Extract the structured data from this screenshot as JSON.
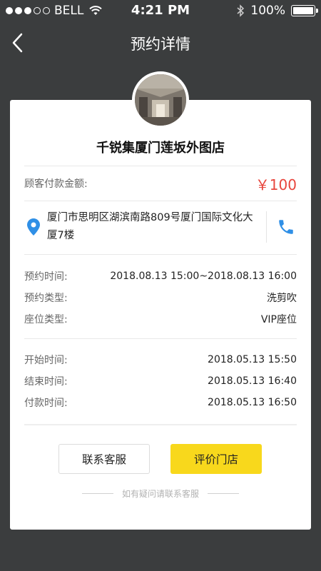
{
  "status_bar": {
    "carrier": "BELL",
    "time": "4:21 PM",
    "battery": "100%"
  },
  "nav": {
    "title": "预约详情"
  },
  "store": {
    "name": "千锐集厦门莲坂外图店"
  },
  "payment": {
    "label": "顾客付款金额:",
    "amount": "￥100"
  },
  "address": {
    "text": "厦门市思明区湖滨南路809号厦门国际文化大厦7楼"
  },
  "booking": [
    {
      "label": "预约时间:",
      "value": "2018.08.13 15:00~2018.08.13 16:00"
    },
    {
      "label": "预约类型:",
      "value": "洗剪吹"
    },
    {
      "label": "座位类型:",
      "value": "VIP座位"
    }
  ],
  "times": [
    {
      "label": "开始时间:",
      "value": "2018.05.13  15:50"
    },
    {
      "label": "结束时间:",
      "value": "2018.05.13  16:40"
    },
    {
      "label": "付款时间:",
      "value": "2018.05.13  16:50"
    }
  ],
  "buttons": {
    "contact": "联系客服",
    "review": "评价门店"
  },
  "footer": {
    "note": "如有疑问请联系客服"
  },
  "colors": {
    "background": "#3b3d3e",
    "price": "#e8453c",
    "accent_button": "#f8d81c",
    "icon_blue": "#2f8fe6"
  }
}
